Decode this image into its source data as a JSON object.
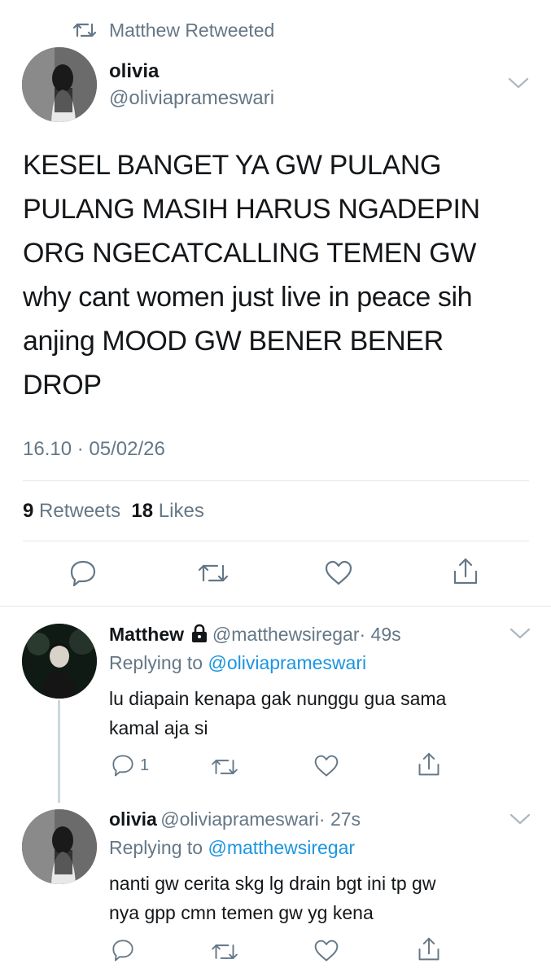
{
  "retweet_header": {
    "text": "Matthew Retweeted",
    "icon": "retweet-icon"
  },
  "main_tweet": {
    "name": "olivia",
    "handle": "@oliviaprameswari",
    "text": "KESEL BANGET YA GW PULANG\nPULANG MASIH HARUS NGADEPIN\nORG NGECATCALLING TEMEN GW\nwhy cant women just live in peace sih\nanjing MOOD GW BENER BENER\nDROP",
    "timestamp": "16.10 · 05/02/26",
    "retweet_count": "9",
    "retweet_label": "Retweets",
    "like_count": "18",
    "like_label": "Likes",
    "actions": [
      "reply-icon",
      "retweet-icon",
      "like-icon",
      "share-icon"
    ]
  },
  "replies": [
    {
      "name": "Matthew",
      "protected_icon": "lock-icon",
      "handle": "@matthewsiregar",
      "time": "· 49s",
      "replying_label": "Replying to",
      "replying_to": "@oliviaprameswari",
      "text_line1": "lu diapain kenapa gak nunggu gua sama",
      "text_line2": "kamal aja si",
      "reply_count": "1"
    },
    {
      "name": "olivia",
      "handle": "@oliviaprameswari",
      "time": "· 27s",
      "replying_label": "Replying to",
      "replying_to": "@matthewsiregar",
      "text_line1": "nanti gw cerita skg lg drain bgt ini tp gw",
      "text_line2": "nya gpp cmn temen gw yg kena",
      "reply_count": ""
    }
  ],
  "colors": {
    "text": "#14171a",
    "secondary": "#657786",
    "link": "#1b95e0",
    "divider": "#e1e8ed"
  }
}
